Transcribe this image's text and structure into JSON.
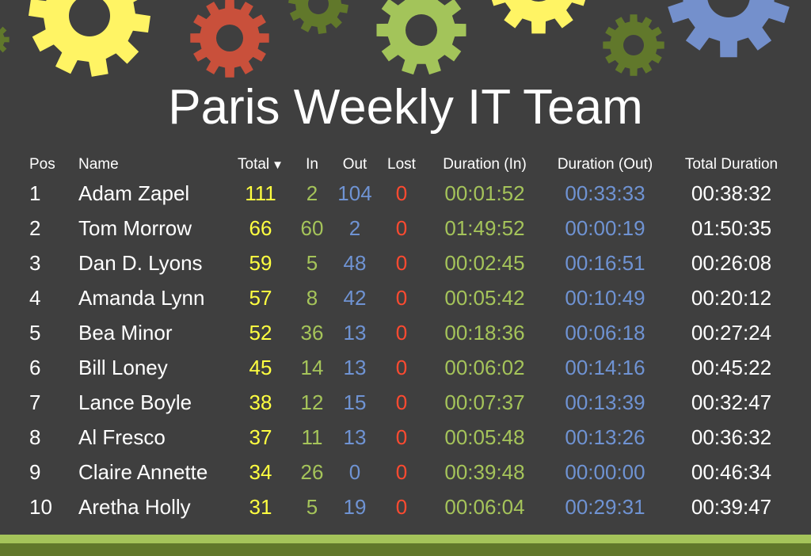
{
  "header": {
    "title": "Paris Weekly IT Team"
  },
  "colors": {
    "background": "#3f3f3f",
    "total": "#ffff40",
    "in": "#a5c45a",
    "out": "#6f93d3",
    "lost": "#ff4a30",
    "gear_yellow": "#fff464",
    "gear_red": "#c9503b",
    "gear_dark_green": "#61782b",
    "gear_light_green": "#a3c45a",
    "gear_blue": "#7490cc"
  },
  "table": {
    "columns": {
      "pos": "Pos",
      "name": "Name",
      "total": "Total",
      "total_sort_icon": "▼",
      "in": "In",
      "out": "Out",
      "lost": "Lost",
      "duration_in": "Duration (In)",
      "duration_out": "Duration (Out)",
      "total_duration": "Total Duration"
    },
    "rows": [
      {
        "pos": "1",
        "name": "Adam Zapel",
        "total": "111",
        "in": "2",
        "out": "104",
        "lost": "0",
        "duration_in": "00:01:52",
        "duration_out": "00:33:33",
        "total_duration": "00:38:32"
      },
      {
        "pos": "2",
        "name": "Tom Morrow",
        "total": "66",
        "in": "60",
        "out": "2",
        "lost": "0",
        "duration_in": "01:49:52",
        "duration_out": "00:00:19",
        "total_duration": "01:50:35"
      },
      {
        "pos": "3",
        "name": "Dan D. Lyons",
        "total": "59",
        "in": "5",
        "out": "48",
        "lost": "0",
        "duration_in": "00:02:45",
        "duration_out": "00:16:51",
        "total_duration": "00:26:08"
      },
      {
        "pos": "4",
        "name": "Amanda Lynn",
        "total": "57",
        "in": "8",
        "out": "42",
        "lost": "0",
        "duration_in": "00:05:42",
        "duration_out": "00:10:49",
        "total_duration": "00:20:12"
      },
      {
        "pos": "5",
        "name": "Bea Minor",
        "total": "52",
        "in": "36",
        "out": "13",
        "lost": "0",
        "duration_in": "00:18:36",
        "duration_out": "00:06:18",
        "total_duration": "00:27:24"
      },
      {
        "pos": "6",
        "name": "Bill Loney",
        "total": "45",
        "in": "14",
        "out": "13",
        "lost": "0",
        "duration_in": "00:06:02",
        "duration_out": "00:14:16",
        "total_duration": "00:45:22"
      },
      {
        "pos": "7",
        "name": "Lance Boyle",
        "total": "38",
        "in": "12",
        "out": "15",
        "lost": "0",
        "duration_in": "00:07:37",
        "duration_out": "00:13:39",
        "total_duration": "00:32:47"
      },
      {
        "pos": "8",
        "name": "Al Fresco",
        "total": "37",
        "in": "11",
        "out": "13",
        "lost": "0",
        "duration_in": "00:05:48",
        "duration_out": "00:13:26",
        "total_duration": "00:36:32"
      },
      {
        "pos": "9",
        "name": "Claire Annette",
        "total": "34",
        "in": "26",
        "out": "0",
        "lost": "0",
        "duration_in": "00:39:48",
        "duration_out": "00:00:00",
        "total_duration": "00:46:34"
      },
      {
        "pos": "10",
        "name": "Aretha Holly",
        "total": "31",
        "in": "5",
        "out": "19",
        "lost": "0",
        "duration_in": "00:06:04",
        "duration_out": "00:29:31",
        "total_duration": "00:39:47"
      }
    ]
  }
}
